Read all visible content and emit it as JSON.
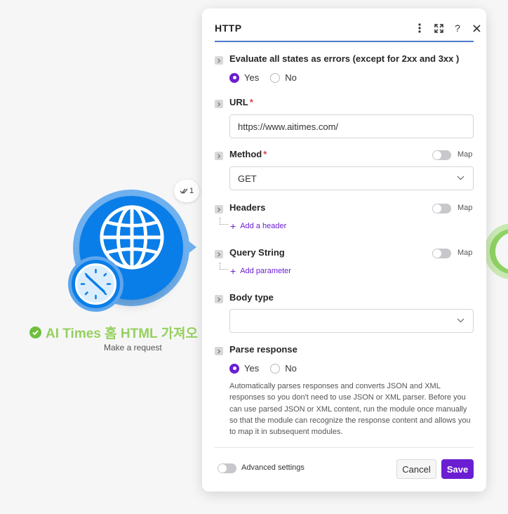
{
  "node": {
    "title": "AI Times 홈 HTML 가져오",
    "subtitle": "Make a request",
    "operations_badge": "1",
    "icons": {
      "app": "globe-icon",
      "scheduler": "clock-icon",
      "status": "check-circle-icon"
    }
  },
  "panel": {
    "title": "HTTP",
    "header_icons": [
      "more-vertical-icon",
      "expand-icon",
      "help-icon",
      "close-icon"
    ],
    "help_glyph": "?",
    "evaluate_errors": {
      "label": "Evaluate all states as errors (except for 2xx and 3xx )",
      "options": [
        "Yes",
        "No"
      ],
      "selected": "Yes"
    },
    "url": {
      "label": "URL",
      "required_mark": "*",
      "value": "https://www.aitimes.com/"
    },
    "method": {
      "label": "Method",
      "required_mark": "*",
      "value": "GET",
      "map_label": "Map",
      "map_enabled": false
    },
    "headers": {
      "label": "Headers",
      "map_label": "Map",
      "map_enabled": false,
      "add_label": "Add a header"
    },
    "query_string": {
      "label": "Query String",
      "map_label": "Map",
      "map_enabled": false,
      "add_label": "Add parameter"
    },
    "body_type": {
      "label": "Body type",
      "value": ""
    },
    "parse_response": {
      "label": "Parse response",
      "options": [
        "Yes",
        "No"
      ],
      "selected": "Yes",
      "help": "Automatically parses responses and converts JSON and XML responses so you don't need to use JSON or XML parser. Before you can use parsed JSON or XML content, run the module once manually so that the module can recognize the response content and allows you to map it in subsequent modules."
    },
    "footer": {
      "advanced_label": "Advanced settings",
      "advanced_enabled": false,
      "cancel_label": "Cancel",
      "save_label": "Save"
    }
  },
  "colors": {
    "accent": "#6b1ed1",
    "http_blue": "#0a7ee8",
    "node_title_green": "#95d05e",
    "required_red": "#e23d3d",
    "header_rule": "#4a77c9"
  }
}
